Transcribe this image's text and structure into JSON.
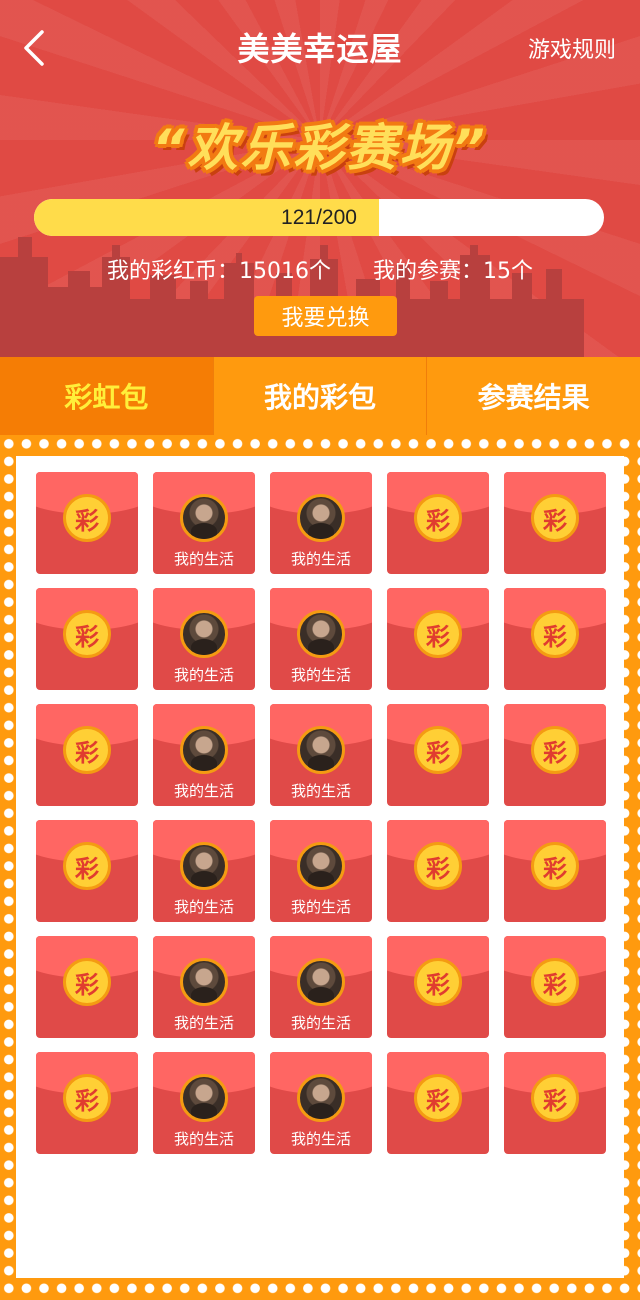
{
  "header": {
    "title": "美美幸运屋",
    "rules_label": "游戏规则",
    "back_icon": "chevron-left-icon",
    "banner_title": "“欢乐彩赛场”",
    "progress": {
      "current": 121,
      "total": 200,
      "text": "121/200",
      "fraction": 0.605
    },
    "coins_text": "我的彩红币：15016个",
    "entries_text": "我的参赛：15个",
    "redeem_label": "我要兑换"
  },
  "tabs": [
    {
      "label": "彩虹包",
      "active": true
    },
    {
      "label": "我的彩包",
      "active": false
    },
    {
      "label": "参赛结果",
      "active": false
    }
  ],
  "packets": {
    "rows": 6,
    "columns": [
      "coin",
      "avatar",
      "avatar",
      "coin",
      "coin"
    ],
    "coin_char": "彩",
    "avatar_label": "我的生活"
  },
  "colors": {
    "header_red": "#e04a44",
    "tab_orange": "#ff9a0e",
    "tab_active": "#f57d05",
    "tab_active_text": "#ffef3a",
    "progress_yellow": "#ffdc4a",
    "packet_red": "#e04a48",
    "packet_flap": "#ff6663",
    "coin_gold": "#ffcf35"
  }
}
